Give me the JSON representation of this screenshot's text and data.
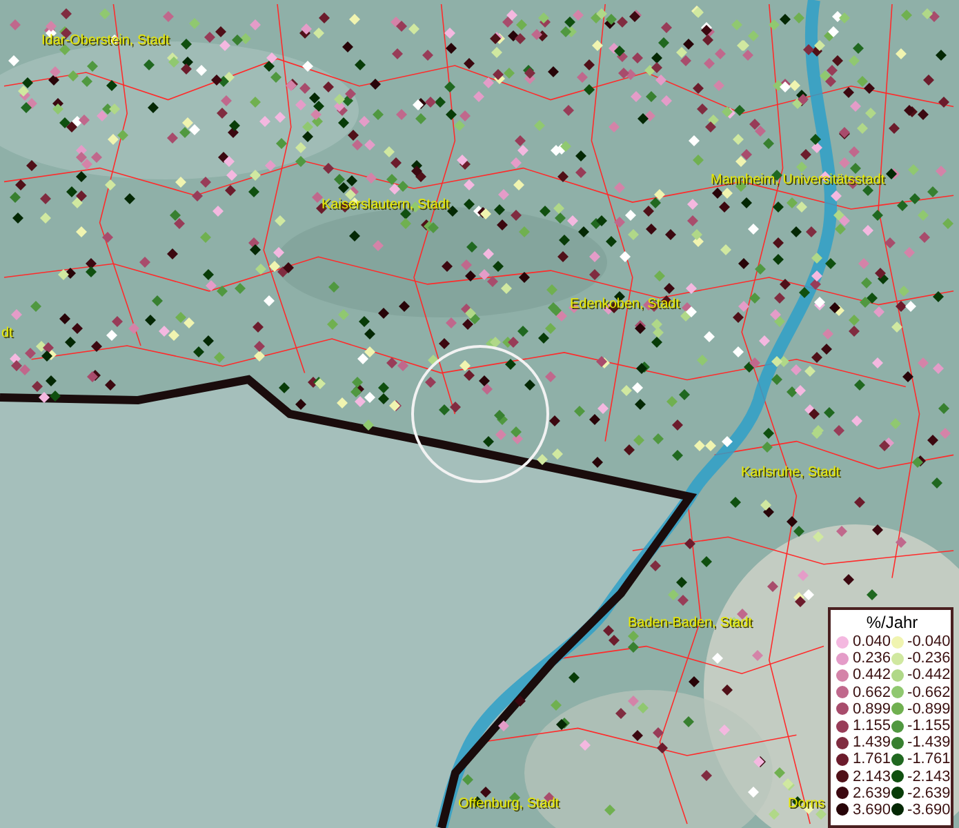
{
  "map": {
    "labels": [
      {
        "text": "Idar-Oberstein, Stadt"
      },
      {
        "text": "Kaiserslautern, Stadt"
      },
      {
        "text": "Mannheim, Universitätsstadt"
      },
      {
        "text": "Edenkoben, Stadt"
      },
      {
        "text": "Karlsruhe, Stadt"
      },
      {
        "text": "Baden-Baden, Stadt"
      },
      {
        "text": "Offenburg, Stadt"
      },
      {
        "text": "Dorns"
      },
      {
        "text": "dt"
      }
    ]
  },
  "legend": {
    "title": "%/Jahr",
    "rows": [
      {
        "increase": {
          "value": "0.040",
          "color": "#f4b8e0"
        },
        "decrease": {
          "value": "-0.040",
          "color": "#f0f4b0"
        }
      },
      {
        "increase": {
          "value": "0.236",
          "color": "#e49cc8"
        },
        "decrease": {
          "value": "-0.236",
          "color": "#d0e8a0"
        }
      },
      {
        "increase": {
          "value": "0.442",
          "color": "#d483a8"
        },
        "decrease": {
          "value": "-0.442",
          "color": "#b0d888"
        }
      },
      {
        "increase": {
          "value": "0.662",
          "color": "#c0688c"
        },
        "decrease": {
          "value": "-0.662",
          "color": "#90c870"
        }
      },
      {
        "increase": {
          "value": "0.899",
          "color": "#a84c6c"
        },
        "decrease": {
          "value": "-0.899",
          "color": "#70b050"
        }
      },
      {
        "increase": {
          "value": "1.155",
          "color": "#983c58"
        },
        "decrease": {
          "value": "-1.155",
          "color": "#509840"
        }
      },
      {
        "increase": {
          "value": "1.439",
          "color": "#802c40"
        },
        "decrease": {
          "value": "-1.439",
          "color": "#388030"
        }
      },
      {
        "increase": {
          "value": "1.761",
          "color": "#6c1c2c"
        },
        "decrease": {
          "value": "-1.761",
          "color": "#206820"
        }
      },
      {
        "increase": {
          "value": "2.143",
          "color": "#501018"
        },
        "decrease": {
          "value": "-2.143",
          "color": "#105010"
        }
      },
      {
        "increase": {
          "value": "2.639",
          "color": "#3c0810"
        },
        "decrease": {
          "value": "-2.639",
          "color": "#083c08"
        }
      },
      {
        "increase": {
          "value": "3.690",
          "color": "#280408"
        },
        "decrease": {
          "value": "-3.690",
          "color": "#042804"
        }
      }
    ]
  }
}
